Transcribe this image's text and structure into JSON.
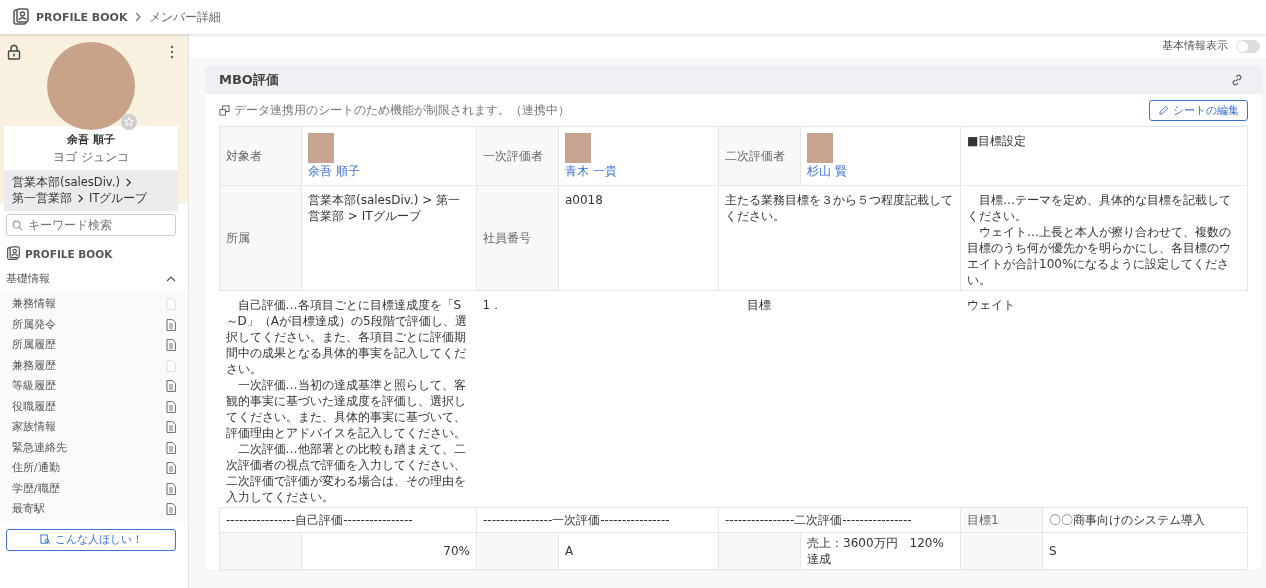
{
  "header": {
    "app_name": "PROFILE BOOK",
    "breadcrumb": "メンバー詳細"
  },
  "profile": {
    "name": "余吾 順子",
    "kana": "ヨゴ ジュンコ",
    "department_path": [
      "営業本部(salesDiv.)",
      "第一営業部",
      "ITグループ"
    ]
  },
  "sidebar": {
    "search": {
      "placeholder": "キーワード検索"
    },
    "brand": "PROFILE BOOK",
    "section": {
      "title": "基礎情報",
      "expanded": true,
      "items": [
        {
          "label": "兼務情報",
          "has_content": false
        },
        {
          "label": "所属発令",
          "has_content": true
        },
        {
          "label": "所属履歴",
          "has_content": true
        },
        {
          "label": "兼務履歴",
          "has_content": false
        },
        {
          "label": "等級履歴",
          "has_content": true
        },
        {
          "label": "役職履歴",
          "has_content": true
        },
        {
          "label": "家族情報",
          "has_content": true
        },
        {
          "label": "緊急連絡先",
          "has_content": true
        },
        {
          "label": "住所/通勤",
          "has_content": true
        },
        {
          "label": "学歴/職歴",
          "has_content": true
        },
        {
          "label": "最寄駅",
          "has_content": true
        }
      ]
    },
    "wish_button": "こんな人ほしい！"
  },
  "toggle": {
    "label": "基本情報表示",
    "on": false
  },
  "card": {
    "title": "MBO評価",
    "notice": "データ連携用のシートのため機能が制限されます。（連携中）",
    "edit_button": "シートの編集",
    "people": [
      {
        "role": "対象者",
        "name": "余吾 順子"
      },
      {
        "role": "一次評価者",
        "name": "青木 一貴"
      },
      {
        "role": "二次評価者",
        "name": "杉山 賢"
      }
    ],
    "goal_heading": "■目標設定",
    "affiliation": {
      "label": "所属",
      "value": "営業本部(salesDiv.) > 第一営業部 > ITグループ"
    },
    "employee_no": {
      "label": "社員番号",
      "value": "a0018"
    },
    "main_goal_note": "主たる業務目標を３から５つ程度記載してください。",
    "goal_guide": [
      "目標…テーマを定め、具体的な目標を記載してください。",
      "ウェイト…上長と本人が擦り合わせて、複数の目標のうち何が優先かを明らかにし、各目標のウエイトが合計100%になるように設定してください。"
    ],
    "eval_guide": [
      "自己評価…各項目ごとに目標達成度を「S～D」（Aが目標達成）の5段階で評価し、選択してください。また、各項目ごとに評価期間中の成果となる具体的事実を記入してください。",
      "一次評価…当初の達成基準と照らして、客観的事実に基づいた達成度を評価し、選択してください。また、具体的事実に基づいて、評価理由とアドバイスを記入してください。",
      "二次評価…他部署との比較も踏まえて、二次評価者の視点で評価を入力してください、二次評価で評価が変わる場合は、その理由を入力してください。"
    ],
    "item_number": "1．",
    "goal_col": "目標",
    "weight_col": "ウェイト",
    "eval_headers": [
      "----------------自己評価----------------",
      "----------------一次評価----------------",
      "----------------二次評価----------------"
    ],
    "goal_label": "目標1",
    "goal_value": "〇〇商事向けのシステム導入",
    "eval_values": [
      "70%",
      "A",
      "売上：3600万円　120%達成",
      "S"
    ]
  }
}
